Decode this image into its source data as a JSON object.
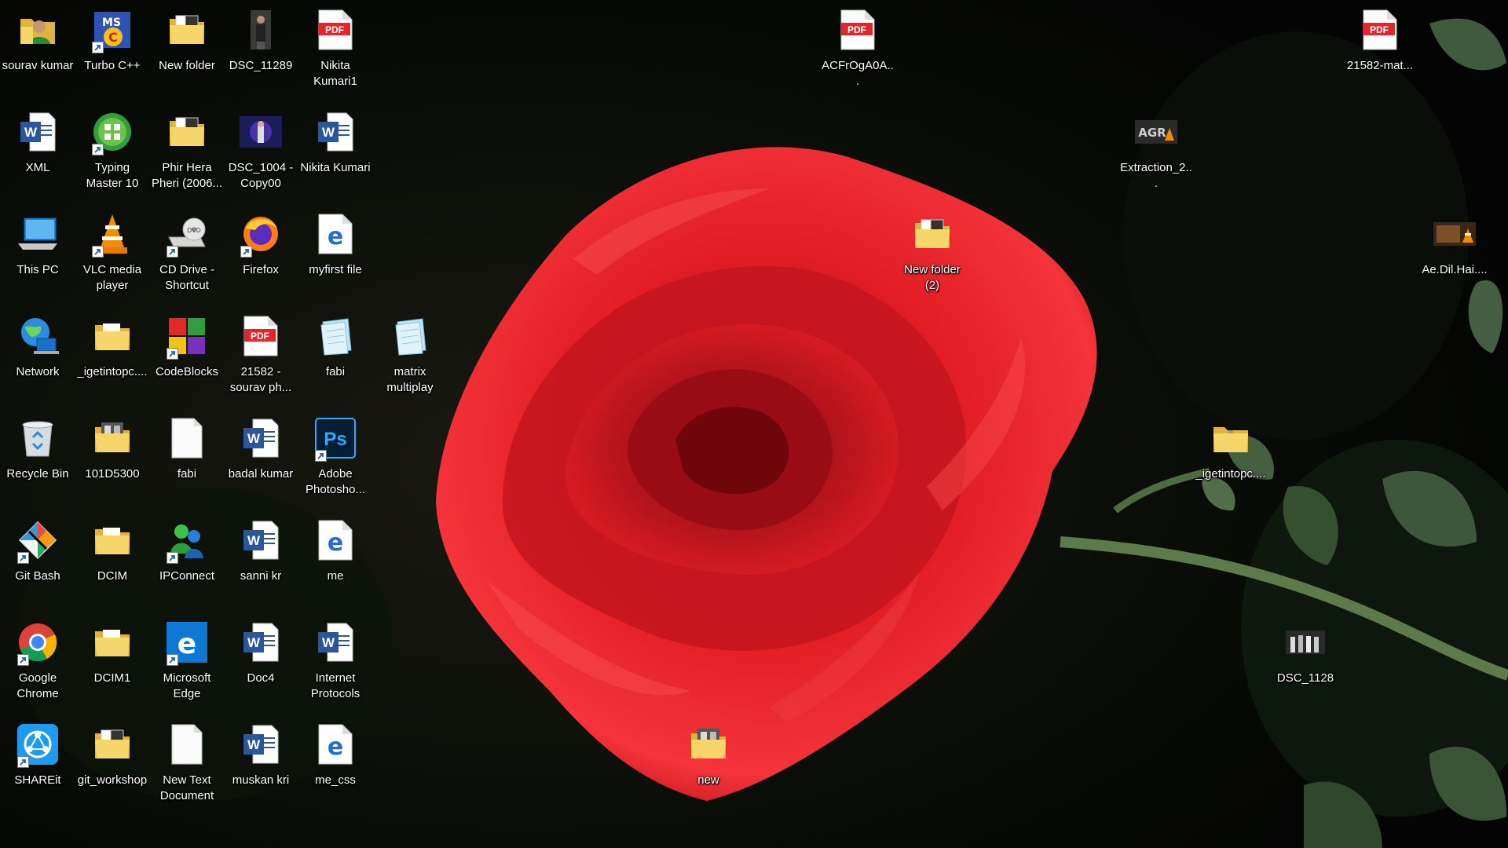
{
  "desktop": {
    "icons": [
      {
        "key": "sourav-kumar",
        "type": "user-folder",
        "label": "sourav kumar",
        "shortcut": false
      },
      {
        "key": "turbo-cpp",
        "type": "turbo",
        "label": "Turbo C++",
        "shortcut": true
      },
      {
        "key": "new-folder",
        "type": "folder-docs",
        "label": "New folder",
        "shortcut": false
      },
      {
        "key": "dsc-11289",
        "type": "photo-person",
        "label": "DSC_11289",
        "shortcut": false
      },
      {
        "key": "nikita-kumari1",
        "type": "pdf",
        "label": "Nikita Kumari1",
        "shortcut": false
      },
      {
        "key": "xml",
        "type": "word",
        "label": "XML",
        "shortcut": false
      },
      {
        "key": "typing-master",
        "type": "typing",
        "label": "Typing Master 10",
        "shortcut": true
      },
      {
        "key": "phir-hera-pheri",
        "type": "folder-docs",
        "label": "Phir Hera Pheri (2006...",
        "shortcut": false
      },
      {
        "key": "dsc-1004",
        "type": "photo-stage",
        "label": "DSC_1004 - Copy00",
        "shortcut": false
      },
      {
        "key": "nikita-kumari",
        "type": "word",
        "label": "Nikita Kumari",
        "shortcut": false
      },
      {
        "key": "this-pc",
        "type": "pc",
        "label": "This PC",
        "shortcut": false
      },
      {
        "key": "vlc",
        "type": "vlc",
        "label": "VLC media player",
        "shortcut": true
      },
      {
        "key": "cd-drive",
        "type": "dvd",
        "label": "CD Drive - Shortcut",
        "shortcut": true
      },
      {
        "key": "firefox",
        "type": "firefox",
        "label": "Firefox",
        "shortcut": true
      },
      {
        "key": "myfirst-file",
        "type": "edge-doc",
        "label": "myfirst file",
        "shortcut": false
      },
      {
        "key": "network",
        "type": "network",
        "label": "Network",
        "shortcut": false
      },
      {
        "key": "igetintopc-1",
        "type": "folder",
        "label": "_igetintopc....",
        "shortcut": false
      },
      {
        "key": "codeblocks",
        "type": "codeblocks",
        "label": "CodeBlocks",
        "shortcut": true
      },
      {
        "key": "21582-sourav",
        "type": "pdf",
        "label": "21582 - sourav ph...",
        "shortcut": false
      },
      {
        "key": "fabi-notepad",
        "type": "notepad",
        "label": "fabi",
        "shortcut": false
      },
      {
        "key": "matrix-multiplay",
        "type": "notepad",
        "label": "matrix multiplay",
        "shortcut": false
      },
      {
        "key": "recycle-bin",
        "type": "recycle",
        "label": "Recycle Bin",
        "shortcut": false
      },
      {
        "key": "101d5300",
        "type": "folder-photo",
        "label": "101D5300",
        "shortcut": false
      },
      {
        "key": "fabi-blank",
        "type": "blank",
        "label": "fabi",
        "shortcut": false
      },
      {
        "key": "badal-kumar",
        "type": "word",
        "label": "badal kumar",
        "shortcut": false
      },
      {
        "key": "adobe-photoshop",
        "type": "ps",
        "label": "Adobe Photosho...",
        "shortcut": true
      },
      {
        "key": "git-bash",
        "type": "git",
        "label": "Git Bash",
        "shortcut": true
      },
      {
        "key": "dcim",
        "type": "folder",
        "label": "DCIM",
        "shortcut": false
      },
      {
        "key": "ipconnect",
        "type": "ipconnect",
        "label": "IPConnect",
        "shortcut": true
      },
      {
        "key": "sanni-kr",
        "type": "word",
        "label": "sanni kr",
        "shortcut": false
      },
      {
        "key": "me",
        "type": "edge-doc",
        "label": "me",
        "shortcut": false
      },
      {
        "key": "google-chrome",
        "type": "chrome",
        "label": "Google Chrome",
        "shortcut": true
      },
      {
        "key": "dcim1",
        "type": "folder",
        "label": "DCIM1",
        "shortcut": false
      },
      {
        "key": "microsoft-edge",
        "type": "edge",
        "label": "Microsoft Edge",
        "shortcut": true
      },
      {
        "key": "doc4",
        "type": "word",
        "label": "Doc4",
        "shortcut": false
      },
      {
        "key": "internet-protocols",
        "type": "word",
        "label": "Internet Protocols",
        "shortcut": false
      },
      {
        "key": "shareit",
        "type": "shareit",
        "label": "SHAREit",
        "shortcut": true
      },
      {
        "key": "git-workshop",
        "type": "folder-docs",
        "label": "git_workshop",
        "shortcut": false
      },
      {
        "key": "new-text-document",
        "type": "blank",
        "label": "New Text Document",
        "shortcut": false
      },
      {
        "key": "muskan-kri",
        "type": "word",
        "label": "muskan kri",
        "shortcut": false
      },
      {
        "key": "me-css",
        "type": "edge-doc",
        "label": "me_css",
        "shortcut": false
      },
      {
        "key": "new",
        "type": "folder-photo",
        "label": "new",
        "shortcut": false
      },
      {
        "key": "acfrog",
        "type": "pdf",
        "label": "ACFrOgA0A...",
        "shortcut": false
      },
      {
        "key": "new-folder-2",
        "type": "folder-docs",
        "label": "New folder (2)",
        "shortcut": false
      },
      {
        "key": "extraction-2",
        "type": "video-agr",
        "label": "Extraction_2...",
        "shortcut": false
      },
      {
        "key": "igetintopc-zip",
        "type": "zip",
        "label": "_igetintopc....",
        "shortcut": false
      },
      {
        "key": "dsc-1128",
        "type": "photo-group",
        "label": "DSC_1128",
        "shortcut": false
      },
      {
        "key": "21582-mat",
        "type": "pdf",
        "label": "21582-mat...",
        "shortcut": false
      },
      {
        "key": "ae-dil-hai",
        "type": "video-vlc",
        "label": "Ae.Dil.Hai....",
        "shortcut": false
      }
    ]
  },
  "colors": {
    "wallpaper_dark": "#050805",
    "rose_red": "#d8141c",
    "rose_bright": "#f23a3e",
    "leaf_green": "#3f5a3c",
    "label_text": "#ffffff",
    "pdf_red": "#e3262b",
    "word_blue": "#2b579a",
    "folder_yellow": "#f3cf5e"
  }
}
